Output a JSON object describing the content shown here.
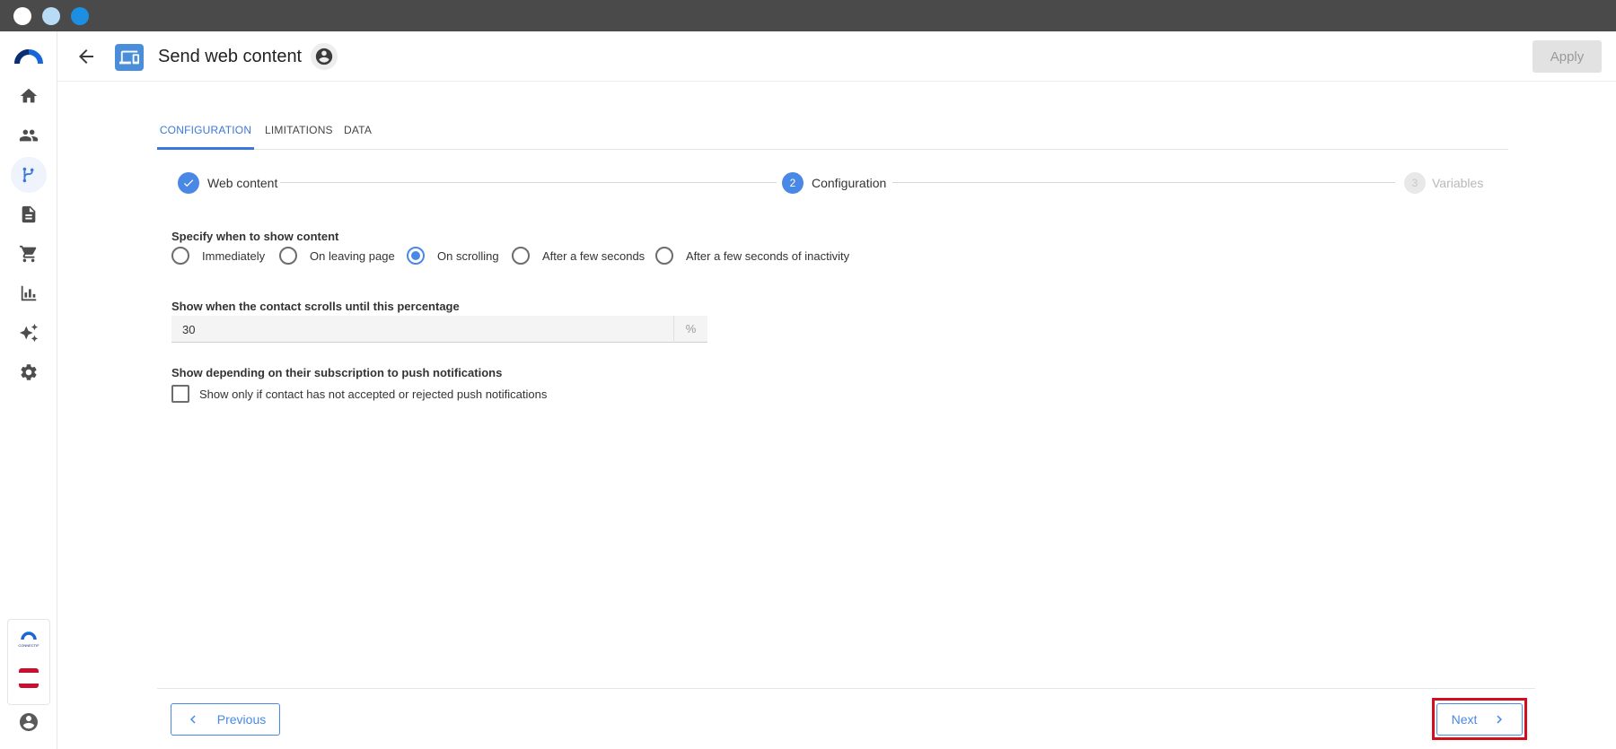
{
  "window": {
    "controls": [
      "close",
      "minimize",
      "maximize"
    ]
  },
  "sidebar": {
    "logo": "brand-logo",
    "items": [
      {
        "name": "home",
        "icon": "home-icon"
      },
      {
        "name": "contacts",
        "icon": "people-icon"
      },
      {
        "name": "workflows",
        "icon": "workflow-branch-icon",
        "active": true
      },
      {
        "name": "content",
        "icon": "document-icon"
      },
      {
        "name": "ecommerce",
        "icon": "cart-icon"
      },
      {
        "name": "analytics",
        "icon": "bar-chart-icon"
      },
      {
        "name": "ai",
        "icon": "sparkle-icon"
      },
      {
        "name": "settings",
        "icon": "gear-icon"
      }
    ],
    "bottom": {
      "brand_small_text": "CONNECTIF",
      "language_flag": "spain-flag-icon",
      "user_icon": "account-circle-icon"
    }
  },
  "header": {
    "title": "Send web content",
    "apply_label": "Apply",
    "apply_disabled": true
  },
  "tabs": [
    {
      "label": "CONFIGURATION",
      "active": true
    },
    {
      "label": "LIMITATIONS",
      "active": false
    },
    {
      "label": "DATA",
      "active": false
    }
  ],
  "stepper": {
    "steps": [
      {
        "number": "1",
        "label": "Web content",
        "state": "completed"
      },
      {
        "number": "2",
        "label": "Configuration",
        "state": "active"
      },
      {
        "number": "3",
        "label": "Variables",
        "state": "pending"
      }
    ]
  },
  "form": {
    "show_when": {
      "label": "Specify when to show content",
      "options": [
        {
          "label": "Immediately",
          "checked": false
        },
        {
          "label": "On leaving page",
          "checked": false
        },
        {
          "label": "On scrolling",
          "checked": true
        },
        {
          "label": "After a few seconds",
          "checked": false
        },
        {
          "label": "After a few seconds of inactivity",
          "checked": false
        }
      ]
    },
    "scroll_percentage": {
      "label": "Show when the contact scrolls until this percentage",
      "value": "30",
      "suffix": "%"
    },
    "push_subscription": {
      "label": "Show depending on their subscription to push notifications",
      "checkbox_label": "Show only if contact has not accepted or rejected push notifications",
      "checked": false
    }
  },
  "footer": {
    "previous_label": "Previous",
    "next_label": "Next"
  },
  "colors": {
    "accent": "#4a88e5",
    "highlight": "#d20f1a",
    "titlebar": "#4a4a4a"
  }
}
